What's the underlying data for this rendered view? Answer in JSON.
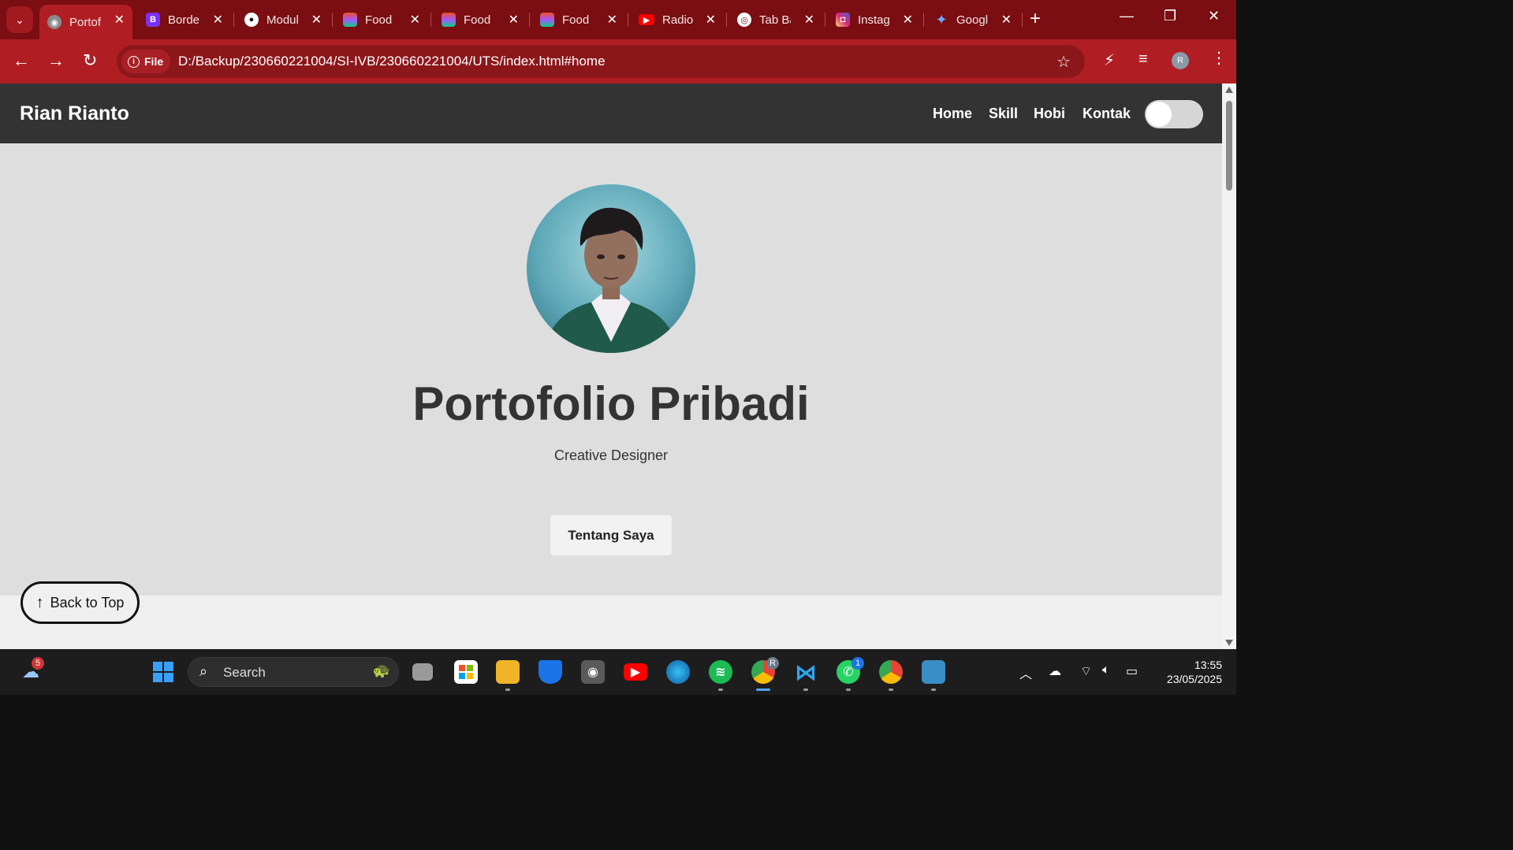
{
  "browser": {
    "tabs": [
      {
        "label": "Portofolio Pribadi",
        "icon": "globe-icon",
        "active": true
      },
      {
        "label": "Border",
        "icon": "bootstrap-icon"
      },
      {
        "label": "Modul",
        "icon": "github-icon"
      },
      {
        "label": "Food",
        "icon": "figma-icon"
      },
      {
        "label": "Food",
        "icon": "figma-icon"
      },
      {
        "label": "Food",
        "icon": "figma-icon"
      },
      {
        "label": "Radio",
        "icon": "youtube-icon"
      },
      {
        "label": "Tab Baru",
        "icon": "chrome-icon"
      },
      {
        "label": "Instagram",
        "icon": "instagram-icon"
      },
      {
        "label": "Google",
        "icon": "gemini-icon"
      }
    ],
    "address": {
      "scheme_label": "File",
      "url": "D:/Backup/230660221004/SI-IVB/230660221004/UTS/index.html#home"
    },
    "profile_initial": "R"
  },
  "site": {
    "brand": "Rian Rianto",
    "nav": [
      "Home",
      "Skill",
      "Hobi",
      "Kontak"
    ],
    "hero": {
      "title": "Portofolio Pribadi",
      "subtitle": "Creative Designer",
      "button": "Tentang Saya"
    },
    "back_to_top": "Back to Top"
  },
  "taskbar": {
    "search_placeholder": "Search",
    "weather_badge": "5",
    "whatsapp_badge": "1",
    "chrome_profile_badge": "R",
    "time": "13:55",
    "date": "23/05/2025"
  },
  "colors": {
    "tabbar": "#7a0e12",
    "toolbar": "#b01e23",
    "site_nav": "#333333",
    "hero_bg": "#dedede"
  }
}
